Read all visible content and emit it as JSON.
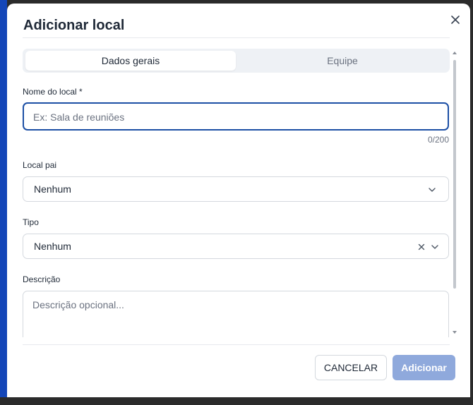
{
  "dialog": {
    "title": "Adicionar local",
    "tabs": [
      {
        "label": "Dados gerais",
        "active": true
      },
      {
        "label": "Equipe",
        "active": false
      }
    ]
  },
  "form": {
    "name": {
      "label": "Nome do local *",
      "placeholder": "Ex: Sala de reuniões",
      "value": "",
      "counter": "0/200"
    },
    "parent": {
      "label": "Local pai",
      "value": "Nenhum"
    },
    "type": {
      "label": "Tipo",
      "value": "Nenhum"
    },
    "description": {
      "label": "Descrição",
      "placeholder": "Descrição opcional..."
    }
  },
  "footer": {
    "cancel_label": "CANCELAR",
    "submit_label": "Adicionar"
  },
  "colors": {
    "accent": "#1c4fa5",
    "primary_disabled": "#8fa9dc",
    "sidebar_strip": "#1446b8"
  },
  "icons": {
    "close": "close-icon",
    "dropdown": "chevron-down-icon",
    "clear": "clear-x-icon"
  }
}
